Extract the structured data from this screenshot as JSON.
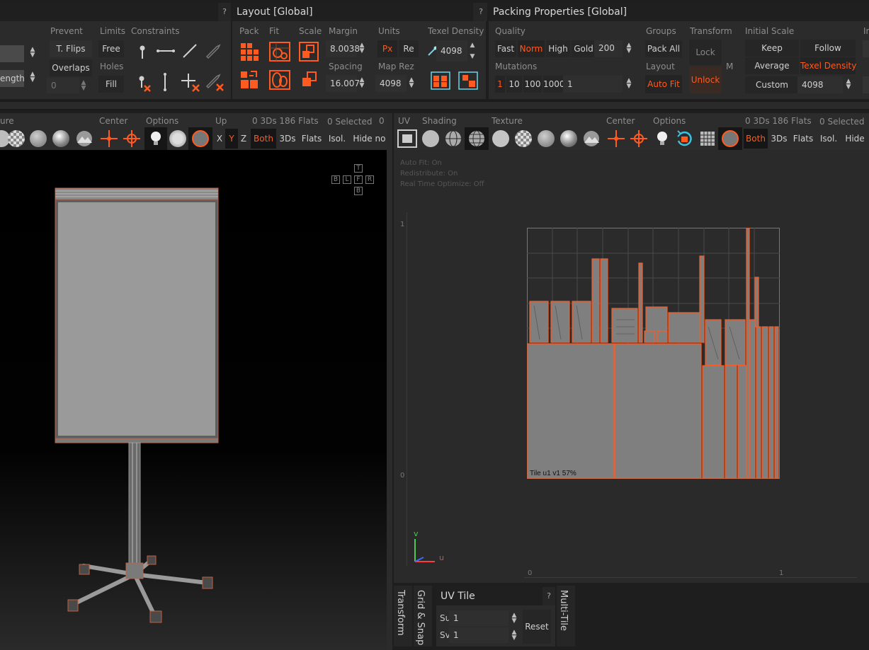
{
  "top_panel": {
    "prevent": {
      "header": "Prevent",
      "t_flips": "T. Flips",
      "overlaps": "Overlaps"
    },
    "limits": {
      "header": "Limits",
      "free": "Free",
      "holes": "Holes",
      "fill": "Fill"
    },
    "constraints": {
      "header": "Constraints"
    },
    "left_stub": {
      "length": "ength",
      "zero": "0"
    }
  },
  "layout": {
    "title": "Layout [Global]",
    "help": "?",
    "pack": "Pack",
    "fit": "Fit",
    "scale": "Scale",
    "margin_label": "Margin",
    "margin_value": "8.0038",
    "spacing_label": "Spacing",
    "spacing_value": "16.007",
    "units_label": "Units",
    "units_px": "Px",
    "units_re": "Re",
    "map_rez_label": "Map Rez",
    "map_rez_value": "4098",
    "texel_label": "Texel Density",
    "texel_value": "4098"
  },
  "packing": {
    "title": "Packing Properties [Global]",
    "help": "?",
    "quality_label": "Quality",
    "quality": [
      "Fast",
      "Norm",
      "High",
      "Gold"
    ],
    "quality_value": "200",
    "mutations_label": "Mutations",
    "mutations": [
      "1",
      "10",
      "100",
      "1000"
    ],
    "mutations_value": "1",
    "groups_label": "Groups",
    "pack_all": "Pack All",
    "layout_label": "Layout",
    "auto_fit": "Auto Fit",
    "transform_label": "Transform",
    "lock": "Lock",
    "m": "M",
    "unlock": "Unlock",
    "initial_scale_label": "Initial Scale",
    "keep": "Keep",
    "follow": "Follow",
    "average": "Average",
    "texel_density": "Texel Density",
    "custom": "Custom",
    "custom_value": "4098",
    "stub": "Ir"
  },
  "left_view": {
    "toolbar": {
      "ure": "ure",
      "center": "Center",
      "options": "Options",
      "up": "Up",
      "stats": "0 3Ds 186 Flats",
      "selected": "0 Selected",
      "zero": "0",
      "x": "X",
      "y": "Y",
      "z": "Z",
      "both": "Both",
      "threeds": "3Ds",
      "flats": "Flats",
      "isol": "Isol.",
      "hide": "Hide",
      "no": "no"
    },
    "cube": {
      "t": "T",
      "b": "B",
      "l": "L",
      "f": "F",
      "r": "R",
      "b2": "B"
    }
  },
  "uv_view": {
    "toolbar": {
      "uv": "UV",
      "shading": "Shading",
      "texture": "Texture",
      "center": "Center",
      "options": "Options",
      "stats": "0 3Ds 186 Flats",
      "selected": "0 Selected",
      "both": "Both",
      "threeds": "3Ds",
      "flats": "Flats",
      "isol": "Isol.",
      "hide": "Hide"
    },
    "info": [
      "Auto Fit: On",
      "Redistribute: On",
      "Real Time Optimize: Off"
    ],
    "axis_one": "1",
    "axis_zero": "0",
    "tile_label": "Tile u1 v1 57%",
    "bottom_zero": "0",
    "bottom_one": "1",
    "axis_v": "v",
    "axis_u": "u"
  },
  "bottom": {
    "transform": "Transform",
    "grid_snap": "Grid & Snap",
    "uv_tile_title": "UV Tile",
    "help": "?",
    "su_label": "Su",
    "su_value": "1",
    "sv_label": "Sv",
    "sv_value": "1",
    "reset": "Reset",
    "multi_tile": "Multi-Tile"
  },
  "colors": {
    "accent": "#ff5a1f",
    "panel": "#2b2b2b",
    "title": "#1f1f1f"
  }
}
